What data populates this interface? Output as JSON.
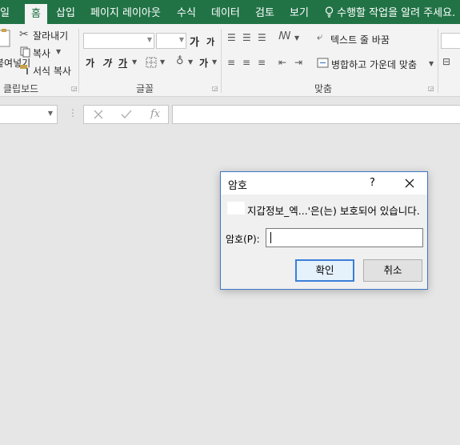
{
  "menubar": {
    "items": [
      {
        "label": "일"
      },
      {
        "label": "홈",
        "active": true
      },
      {
        "label": "삽입"
      },
      {
        "label": "페이지 레이아웃"
      },
      {
        "label": "수식"
      },
      {
        "label": "데이터"
      },
      {
        "label": "검토"
      },
      {
        "label": "보기"
      }
    ],
    "tell_me": "수행할 작업을 알려 주세요.",
    "tell_me_icon": "lightbulb-icon"
  },
  "ribbon": {
    "clipboard": {
      "paste_label": "붙여넣기",
      "cut": "잘라내기",
      "copy": "복사",
      "format_painter": "서식 복사",
      "group_label": "클립보드"
    },
    "font": {
      "font_name": "",
      "font_size": "",
      "grow": "가",
      "shrink": "가",
      "bold": "가",
      "italic": "가",
      "underline": "가",
      "font_color_letter": "가",
      "group_label": "글꼴"
    },
    "alignment": {
      "wrap_text": "텍스트 줄 바꿈",
      "merge_center": "병합하고 가운데 맞춤",
      "group_label": "맞춤"
    }
  },
  "formula_bar": {
    "name_box": "",
    "fx": "fx",
    "formula": ""
  },
  "dialog": {
    "title": "암호",
    "help": "?",
    "message": "지갑정보_엑...'은(는) 보호되어 있습니다.",
    "password_label": "암호(P):",
    "password_value": "",
    "ok": "확인",
    "cancel": "취소"
  },
  "colors": {
    "accent": "#217346",
    "dialog_border": "#3f77c3",
    "workspace": "#e6e6e6"
  }
}
